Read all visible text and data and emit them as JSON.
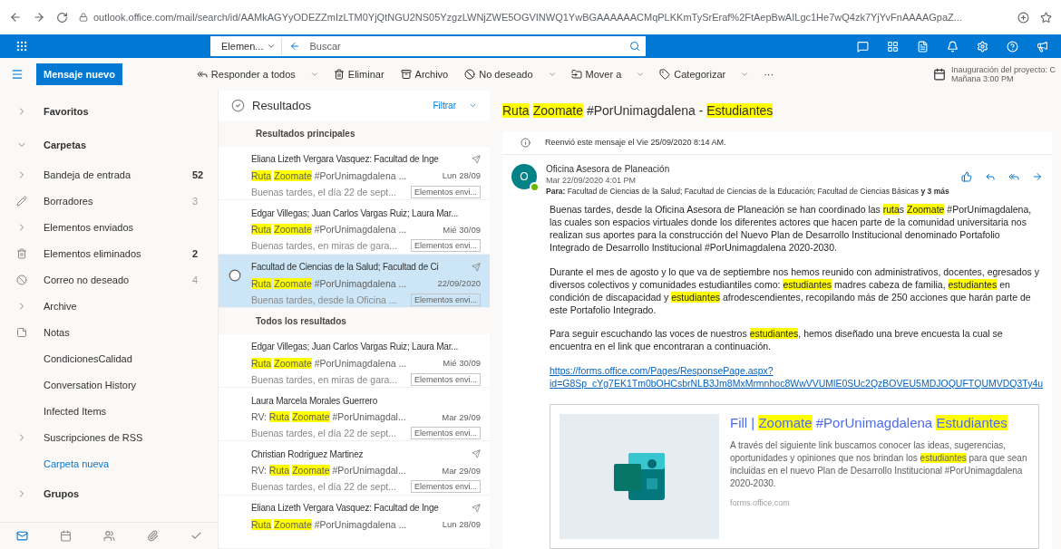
{
  "browser": {
    "url": "outlook.office.com/mail/search/id/AAMkAGYyODEZZmIzLTM0YjQtNGU2NS05YzgzLWNjZWE5OGVINWQ1YwBGAAAAAACMqPLKKmTySrEraf%2FtAepBwAILgc1He7wQ4zk7YjYvFnAAAAGpaZ..."
  },
  "topbar": {
    "scope": "Elemen...",
    "search_placeholder": "Buscar"
  },
  "commands": {
    "new_message": "Mensaje nuevo",
    "actions": [
      {
        "label": "Responder a todos",
        "dropdown": true
      },
      {
        "label": "Eliminar",
        "dropdown": false
      },
      {
        "label": "Archivo",
        "dropdown": false
      },
      {
        "label": "No deseado",
        "dropdown": true
      },
      {
        "label": "Mover a",
        "dropdown": true
      },
      {
        "label": "Categorizar",
        "dropdown": true
      }
    ],
    "more": "···",
    "reminder": {
      "title": "Inauguración del proyecto: C",
      "time": "Mañana 3:00 PM"
    }
  },
  "sidebar": {
    "items": [
      {
        "kind": "section",
        "label": "Favoritos",
        "expanded": false
      },
      {
        "kind": "section",
        "label": "Carpetas",
        "expanded": true
      },
      {
        "kind": "folder",
        "label": "Bandeja de entrada",
        "count": "52",
        "unread": true
      },
      {
        "kind": "folder",
        "label": "Borradores",
        "count": "3",
        "unread": false
      },
      {
        "kind": "folder",
        "label": "Elementos enviados"
      },
      {
        "kind": "folder",
        "label": "Elementos eliminados",
        "count": "2",
        "unread": true
      },
      {
        "kind": "folder",
        "label": "Correo no deseado",
        "count": "4",
        "unread": false
      },
      {
        "kind": "folder",
        "label": "Archive"
      },
      {
        "kind": "folder",
        "label": "Notas"
      },
      {
        "kind": "folder",
        "label": "CondicionesCalidad"
      },
      {
        "kind": "folder",
        "label": "Conversation History"
      },
      {
        "kind": "folder",
        "label": "Infected Items"
      },
      {
        "kind": "folder",
        "label": "Suscripciones de RSS"
      },
      {
        "kind": "link",
        "label": "Carpeta nueva"
      },
      {
        "kind": "section",
        "label": "Grupos",
        "expanded": false
      }
    ]
  },
  "list": {
    "title": "Resultados",
    "filter": "Filtrar",
    "groups": [
      {
        "title": "Resultados principales",
        "messages": [
          {
            "sender": "Eliana Lizeth Vergara Vasquez: Facultad de Inge",
            "forwarded": true,
            "selected": false,
            "subject": [
              {
                "text": "Ruta",
                "highlight": true
              },
              {
                "text": "Zoomate",
                "highlight": true,
                "space_before": true
              },
              {
                "text": " #PorUnimagdalena ...",
                "highlight": false
              }
            ],
            "date": "Lun 28/09",
            "preview": "Buenas tardes, el día 22 de sept...",
            "folder": "Elementos envi..."
          },
          {
            "sender": "Edgar Villegas; Juan Carlos Vargas Ruiz; Laura Mar...",
            "forwarded": false,
            "selected": false,
            "subject": [
              {
                "text": "Ruta",
                "highlight": true
              },
              {
                "text": "Zoomate",
                "highlight": true,
                "space_before": true
              },
              {
                "text": " #PorUnimagdalena ...",
                "highlight": false
              }
            ],
            "date": "Mié 30/09",
            "preview": "Buenas tardes, en miras de gara...",
            "folder": "Elementos envi..."
          },
          {
            "sender": "Facultad de Ciencias de la Salud; Facultad de Ci",
            "forwarded": true,
            "selected": true,
            "subject": [
              {
                "text": "Ruta",
                "highlight": true
              },
              {
                "text": "Zoomate",
                "highlight": true,
                "space_before": true
              },
              {
                "text": " #PorUnimagdalena ...",
                "highlight": false
              }
            ],
            "date": "22/09/2020",
            "preview": "Buenas tardes, desde la Oficina ...",
            "folder": "Elementos envi..."
          }
        ]
      },
      {
        "title": "Todos los resultados",
        "messages": [
          {
            "sender": "Edgar Villegas; Juan Carlos Vargas Ruiz; Laura Mar...",
            "forwarded": false,
            "selected": false,
            "subject": [
              {
                "text": "Ruta",
                "highlight": true
              },
              {
                "text": "Zoomate",
                "highlight": true,
                "space_before": true
              },
              {
                "text": " #PorUnimagdalena ...",
                "highlight": false
              }
            ],
            "date": "Mié 30/09",
            "preview": "Buenas tardes, en miras de gara...",
            "folder": "Elementos envi..."
          },
          {
            "sender": "Laura Marcela Morales Guerrero",
            "forwarded": false,
            "selected": false,
            "subject": [
              {
                "text": "RV: ",
                "highlight": false
              },
              {
                "text": "Ruta",
                "highlight": true
              },
              {
                "text": "Zoomate",
                "highlight": true,
                "space_before": true
              },
              {
                "text": " #PorUnimagdal...",
                "highlight": false
              }
            ],
            "date": "Mar 29/09",
            "preview": "Buenas tardes, el día 22 de sept...",
            "folder": "Elementos envi..."
          },
          {
            "sender": "Christian Rodriguez Martinez",
            "forwarded": true,
            "selected": false,
            "subject": [
              {
                "text": "RV: ",
                "highlight": false
              },
              {
                "text": "Ruta",
                "highlight": true
              },
              {
                "text": "Zoomate",
                "highlight": true,
                "space_before": true
              },
              {
                "text": " #PorUnimagdal...",
                "highlight": false
              }
            ],
            "date": "Mar 29/09",
            "preview": "Buenas tardes, el día 22 de sept...",
            "folder": "Elementos envi..."
          },
          {
            "sender": "Eliana Lizeth Vergara Vasquez: Facultad de Inge",
            "forwarded": true,
            "selected": false,
            "subject": [
              {
                "text": "Ruta",
                "highlight": true
              },
              {
                "text": "Zoomate",
                "highlight": true,
                "space_before": true
              },
              {
                "text": " #PorUnimagdalena ...",
                "highlight": false
              }
            ],
            "date": "Lun 28/09"
          }
        ]
      }
    ]
  },
  "reading": {
    "subject": [
      {
        "text": "Ruta",
        "highlight": true
      },
      {
        "text": "Zoomate",
        "highlight": true,
        "space_before": true
      },
      {
        "text": " #PorUnimagdalena - ",
        "highlight": false
      },
      {
        "text": "Estudiantes",
        "highlight": true
      }
    ],
    "notice": "Reenvió este mensaje el Vie 25/09/2020 8:14 AM.",
    "avatar": "O",
    "sender": "Oficina Asesora de Planeación",
    "date": "Mar 22/09/2020 4:01 PM",
    "to_label": "Para:",
    "to": "Facultad de Ciencias de la Salud; Facultad de Ciencias de la Educación; Facultad de Ciencias Básicas",
    "to_more": "y 3 más",
    "paragraphs": [
      [
        {
          "text": "Buenas tardes, desde la Oficina Asesora de Planeación se han coordinado las ",
          "highlight": false
        },
        {
          "text": "ruta",
          "highlight": true
        },
        {
          "text": "s ",
          "highlight": false
        },
        {
          "text": "Zoomate",
          "highlight": true
        },
        {
          "text": " #PorUnimagdalena, las cuales son espacios virtuales donde los diferentes actores que hacen parte de la comunidad universitaria nos realizan sus aportes para la construcción del Nuevo Plan de Desarrollo Institucional denominado Portafolio Integrado de Desarrollo Institucional #PorUnimagdalena 2020-2030.",
          "highlight": false
        }
      ],
      [
        {
          "text": "Durante el mes de agosto y lo que va de septiembre nos hemos reunido con administrativos, docentes, egresados y diversos colectivos y comunidades estudiantiles como: ",
          "highlight": false
        },
        {
          "text": "estudiantes",
          "highlight": true
        },
        {
          "text": " madres cabeza de familia, ",
          "highlight": false
        },
        {
          "text": "estudiantes",
          "highlight": true
        },
        {
          "text": " en condición de discapacidad y ",
          "highlight": false
        },
        {
          "text": "estudiantes",
          "highlight": true
        },
        {
          "text": " afrodescendientes, recopilando más de 250 acciones que harán parte de este Portafolio Integrado.",
          "highlight": false
        }
      ],
      [
        {
          "text": "Para seguir escuchando las voces de nuestros ",
          "highlight": false
        },
        {
          "text": "estudiantes",
          "highlight": true
        },
        {
          "text": ", hemos diseñado una breve encuesta la cual se encuentra en el link que encontraran a continuación.",
          "highlight": false
        }
      ]
    ],
    "link": [
      "https://forms.office.com/Pages/ResponsePage.aspx?",
      "id=G8Sp_cYg7EK1Tm0bOHCsbrNLB3Jm8MxMrmnhoc8WwVVUMlE0SUc2QzBOVEU5MDJOQUFTQUMVDQ3Ty4u"
    ],
    "card": {
      "title": [
        {
          "text": "Fill | ",
          "highlight": false
        },
        {
          "text": "Zoomate",
          "highlight": true
        },
        {
          "text": " #PorUnimagdalena ",
          "highlight": false
        },
        {
          "text": "Estudiantes",
          "highlight": true
        }
      ],
      "description": [
        {
          "text": "A través del siguiente link buscamos conocer las ideas, sugerencias, oportunidades y opiniones que nos brindan los ",
          "highlight": false
        },
        {
          "text": "estudiantes",
          "highlight": true
        },
        {
          "text": " para que sean incluidas en el nuevo Plan de Desarrollo Institucional #PorUnimagdalena 2020-2030.",
          "highlight": false
        }
      ],
      "domain": "forms.office.com"
    }
  }
}
